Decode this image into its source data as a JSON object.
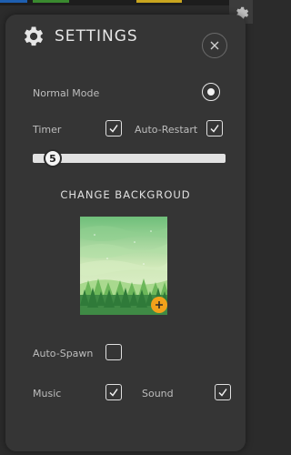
{
  "header": {
    "title": "SETTINGS"
  },
  "mode": {
    "label": "Normal Mode",
    "selected": true
  },
  "timer": {
    "label": "Timer",
    "checked": true
  },
  "auto_restart": {
    "label": "Auto-Restart",
    "checked": true
  },
  "slider": {
    "value": "5",
    "min": 0,
    "max": 60
  },
  "background": {
    "section_title": "CHANGE BACKGROUD"
  },
  "auto_spawn": {
    "label": "Auto-Spawn",
    "checked": false
  },
  "music": {
    "label": "Music",
    "checked": true
  },
  "sound": {
    "label": "Sound",
    "checked": true
  },
  "colors": {
    "panel": "#353535",
    "accent": "#f2a11b",
    "forest": "#3f8a45"
  }
}
